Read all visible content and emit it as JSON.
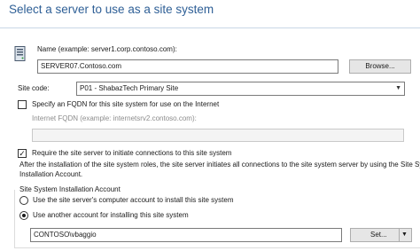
{
  "header": {
    "title": "Select a server to use as a site system"
  },
  "name": {
    "label": "Name (example: server1.corp.contoso.com):",
    "value": "SERVER07.Contoso.com",
    "browse_label": "Browse..."
  },
  "site_code": {
    "label": "Site code:",
    "selected": "P01 - ShabazTech Primary Site"
  },
  "fqdn": {
    "checkbox_label": "Specify an FQDN for this site system for use on the Internet",
    "checked": false,
    "internet_fqdn_label": "Internet FQDN (example: internetsrv2.contoso.com):",
    "value": ""
  },
  "require": {
    "checkbox_label": "Require the site server to initiate connections to this site system",
    "checked": true,
    "checkmark": "✓",
    "description_line1": "After the  installation of the site system roles, the site server initiates all connections to the site system server by using the Site System",
    "description_line2": "Installation Account."
  },
  "install_account": {
    "group_label": "Site System Installation Account",
    "option1_label": "Use the site server's computer account to install this site system",
    "option2_label": "Use another account for installing this site system",
    "selected_option": 2,
    "account_value": "CONTOSO\\vbaggio",
    "set_label": "Set..."
  },
  "icons": {
    "server": "server-icon",
    "dropdown": "chevron-down-icon"
  },
  "colors": {
    "title": "#2e5f96",
    "rule": "#c8d6e6"
  }
}
